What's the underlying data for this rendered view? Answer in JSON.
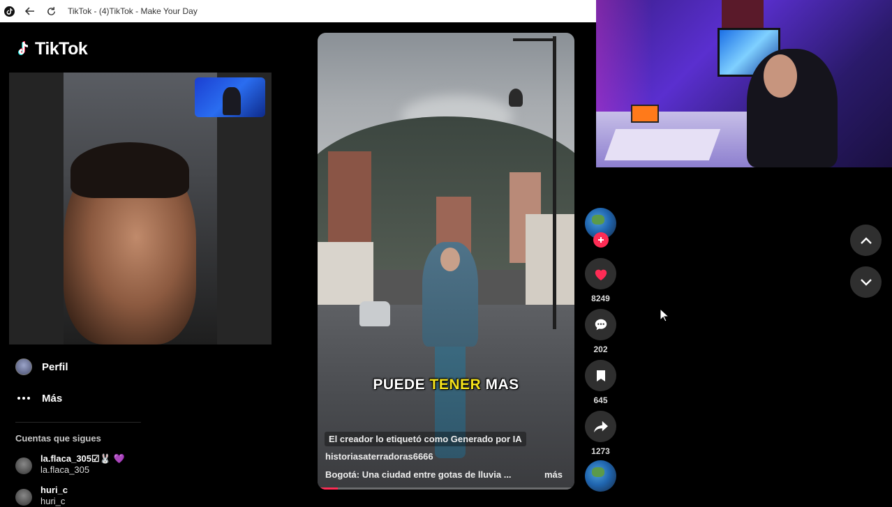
{
  "window": {
    "title": "TikTok - (4)TikTok - Make Your Day"
  },
  "sidebar": {
    "logo_text": "TikTok",
    "nav": [
      {
        "label": "Perfil",
        "icon": "profile-avatar"
      },
      {
        "label": "Más",
        "icon": "more-dots-icon"
      }
    ],
    "following_title": "Cuentas que sigues",
    "following": [
      {
        "name": "la.flaca_305☑🐰 💜",
        "subname": "la.flaca_305"
      },
      {
        "name": "huri_c",
        "subname": "huri_c"
      }
    ]
  },
  "video": {
    "overlay_text_pre": "PUEDE ",
    "overlay_text_highlight": "TENER",
    "overlay_text_post": " MAS",
    "ai_label": "El creador lo etiquetó como Generado por IA",
    "author": "historiasaterradoras6666",
    "description": "Bogotá: Una ciudad entre gotas de lluvia ...",
    "more_label": "más",
    "progress": 0.08
  },
  "actions": {
    "likes": "8249",
    "comments": "202",
    "saves": "645",
    "shares": "1273"
  },
  "colors": {
    "accent": "#fe2c55",
    "highlight": "#f5e31c",
    "action_bg": "#2f2f2f"
  }
}
